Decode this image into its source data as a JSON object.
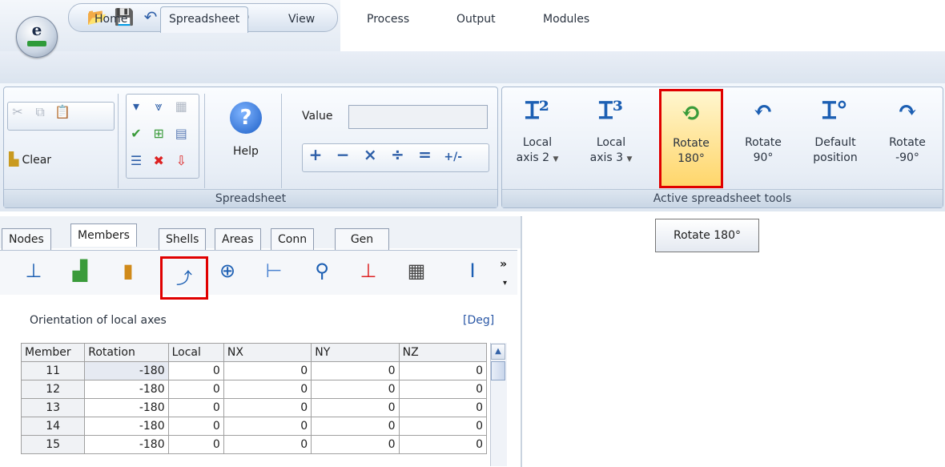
{
  "app": {
    "logo_letter": "e"
  },
  "quick_access": {
    "icons": [
      "open-folder-icon",
      "save-icon",
      "undo-icon",
      "font-icon",
      "zoom-icon",
      "search-icon",
      "power-icon"
    ]
  },
  "tabs": [
    {
      "label": "Home"
    },
    {
      "label": "Spreadsheet",
      "active": true
    },
    {
      "label": "View"
    },
    {
      "label": "Process"
    },
    {
      "label": "Output"
    },
    {
      "label": "Modules"
    }
  ],
  "ribbon": {
    "spreadsheet_group": {
      "label": "Spreadsheet",
      "clear_label": "Clear",
      "help_label": "Help",
      "help_glyph": "?",
      "value_label": "Value",
      "value_input": "",
      "ops": [
        "+",
        "−",
        "×",
        "÷",
        "=",
        "+/-"
      ]
    },
    "active_tools_group": {
      "label": "Active spreadsheet tools",
      "tools": [
        {
          "line1": "Local",
          "line2": "axis 2",
          "dropdown": true,
          "icon": "local-axis-2-icon",
          "glyph": "Ɪ²"
        },
        {
          "line1": "Local",
          "line2": "axis 3",
          "dropdown": true,
          "icon": "local-axis-3-icon",
          "glyph": "Ɪ³"
        },
        {
          "line1": "Rotate",
          "line2": "180°",
          "dropdown": false,
          "icon": "rotate-180-icon",
          "glyph": "⟲",
          "highlighted": true
        },
        {
          "line1": "Rotate",
          "line2": "90°",
          "dropdown": false,
          "icon": "rotate-90-icon",
          "glyph": "↶"
        },
        {
          "line1": "Default",
          "line2": "position",
          "dropdown": false,
          "icon": "default-position-icon",
          "glyph": "Ɪ°"
        },
        {
          "line1": "Rotate",
          "line2": "-90°",
          "dropdown": false,
          "icon": "rotate-minus-90-icon",
          "glyph": "↷"
        }
      ]
    }
  },
  "tooltip": {
    "text": "Rotate 180°"
  },
  "panel": {
    "tabs": [
      {
        "label": "Nodes"
      },
      {
        "label": "Members",
        "active": true
      },
      {
        "label": "Shells"
      },
      {
        "label": "Areas"
      },
      {
        "label": "Conn"
      },
      {
        "label": "Gen"
      }
    ],
    "section_title": "Orientation of local axes",
    "unit": "[Deg]",
    "table": {
      "headers": [
        "Member",
        "Rotation",
        "Local",
        "NX",
        "NY",
        "NZ"
      ],
      "rows": [
        [
          "11",
          "-180",
          "0",
          "0",
          "0",
          "0"
        ],
        [
          "12",
          "-180",
          "0",
          "0",
          "0",
          "0"
        ],
        [
          "13",
          "-180",
          "0",
          "0",
          "0",
          "0"
        ],
        [
          "14",
          "-180",
          "0",
          "0",
          "0",
          "0"
        ],
        [
          "15",
          "-180",
          "0",
          "0",
          "0",
          "0"
        ]
      ]
    }
  },
  "colors": {
    "highlight": "#e00000",
    "accent": "#1c5fb3"
  }
}
